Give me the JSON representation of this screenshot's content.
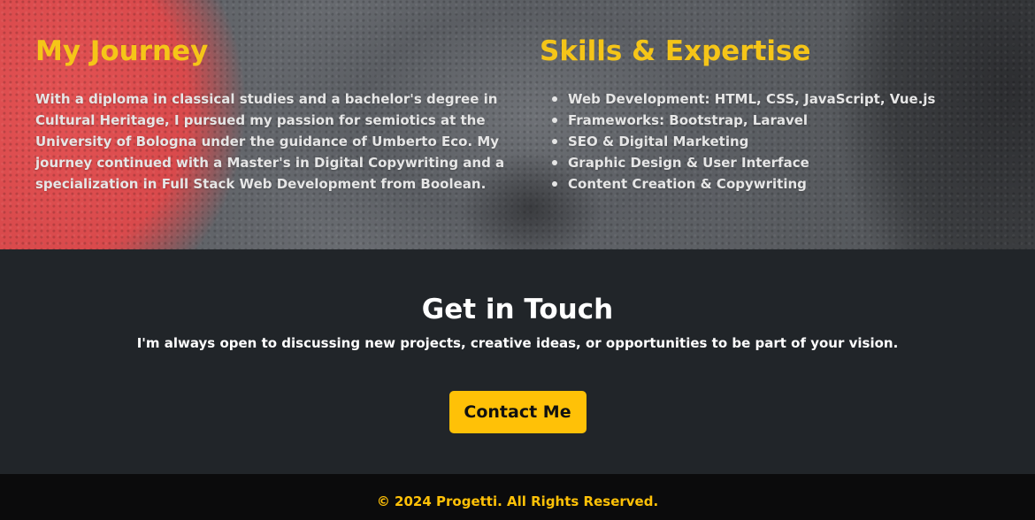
{
  "journey": {
    "title": "My Journey",
    "text": "With a diploma in classical studies and a bachelor's degree in Cultural Heritage, I pursued my passion for semiotics at the University of Bologna under the guidance of Umberto Eco. My journey continued with a Master's in Digital Copywriting and a specialization in Full Stack Web Development from Boolean."
  },
  "skills": {
    "title": "Skills & Expertise",
    "items": [
      "Web Development: HTML, CSS, JavaScript, Vue.js",
      "Frameworks: Bootstrap, Laravel",
      "SEO & Digital Marketing",
      "Graphic Design & User Interface",
      "Content Creation & Copywriting"
    ]
  },
  "contact": {
    "title": "Get in Touch",
    "subtitle": "I'm always open to discussing new projects, creative ideas, or opportunities to be part of your vision.",
    "button_label": "Contact Me"
  },
  "footer": {
    "text": "© 2024 Progetti. All Rights Reserved."
  },
  "colors": {
    "accent": "#ffc107",
    "heading_yellow": "#f5c518",
    "dark_bg": "#212529",
    "footer_bg": "#0b0b0c"
  }
}
